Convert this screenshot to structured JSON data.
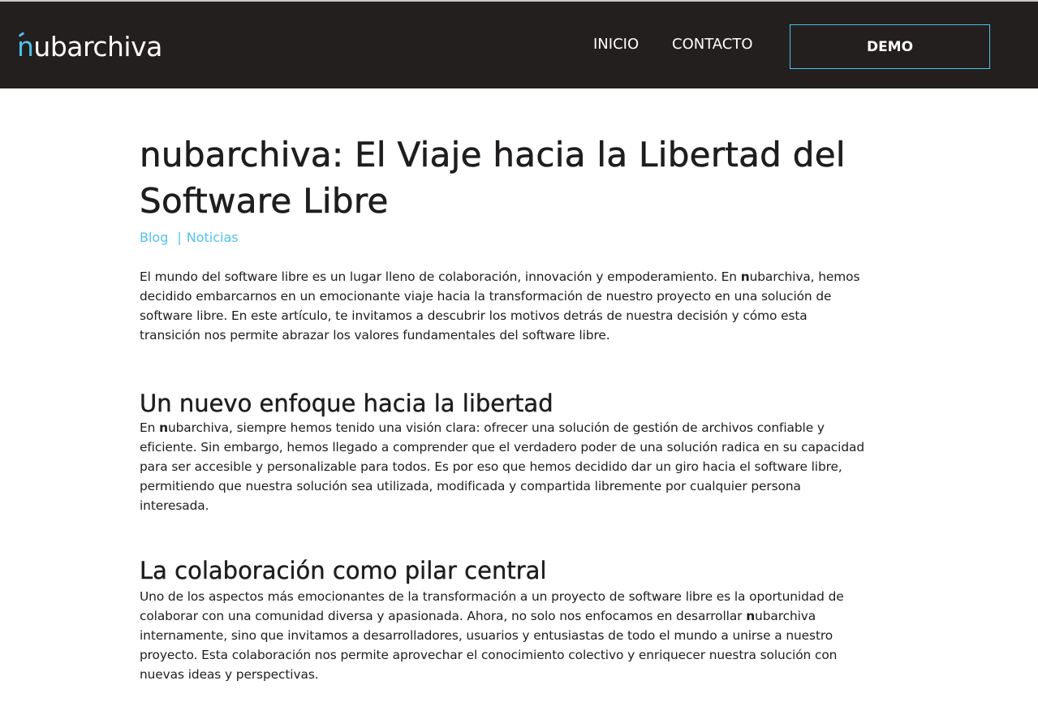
{
  "header": {
    "logo_n": "n",
    "logo_rest": "ubarchiva",
    "nav": {
      "inicio": "INICIO",
      "contacto": "CONTACTO",
      "demo": "DEMO"
    }
  },
  "colors": {
    "accent": "#4fc3ea",
    "header_bg": "#231f1e",
    "text": "#1f1d1d"
  },
  "article": {
    "title": "nubarchiva: El Viaje hacia la Libertad del Software Libre",
    "categories": [
      "Blog",
      "Noticias"
    ],
    "category_separator": "|",
    "intro": {
      "before": "El mundo del software libre es un lugar lleno de colaboración, innovación y empoderamiento. En ",
      "brand_n": "n",
      "after": "ubarchiva, hemos decidido embarcarnos en un emocionante viaje hacia la transformación de nuestro proyecto en una solución de software libre. En este artículo, te invitamos a descubrir los motivos detrás de nuestra decisión y cómo esta transición nos permite abrazar los valores fundamentales del software libre."
    },
    "sections": [
      {
        "heading": "Un nuevo enfoque hacia la libertad",
        "before": "En ",
        "brand_n": "n",
        "after": "ubarchiva, siempre hemos tenido una visión clara: ofrecer una solución de gestión de archivos confiable y eficiente. Sin embargo, hemos llegado a comprender que el verdadero poder de una solución radica en su capacidad para ser accesible y personalizable para todos. Es por eso que hemos decidido dar un giro hacia el software libre, permitiendo que nuestra solución sea utilizada, modificada y compartida libremente por cualquier persona interesada."
      },
      {
        "heading": "La colaboración como pilar central",
        "before": "Uno de los aspectos más emocionantes de la transformación a un proyecto de software libre es la oportunidad de colaborar con una comunidad diversa y apasionada. Ahora, no solo nos enfocamos en desarrollar ",
        "brand_n": "n",
        "after": "ubarchiva internamente, sino que invitamos a desarrolladores, usuarios y entusiastas de todo el mundo a unirse a nuestro proyecto. Esta colaboración nos permite aprovechar el conocimiento colectivo y enriquecer nuestra solución con nuevas ideas y perspectivas."
      }
    ]
  }
}
